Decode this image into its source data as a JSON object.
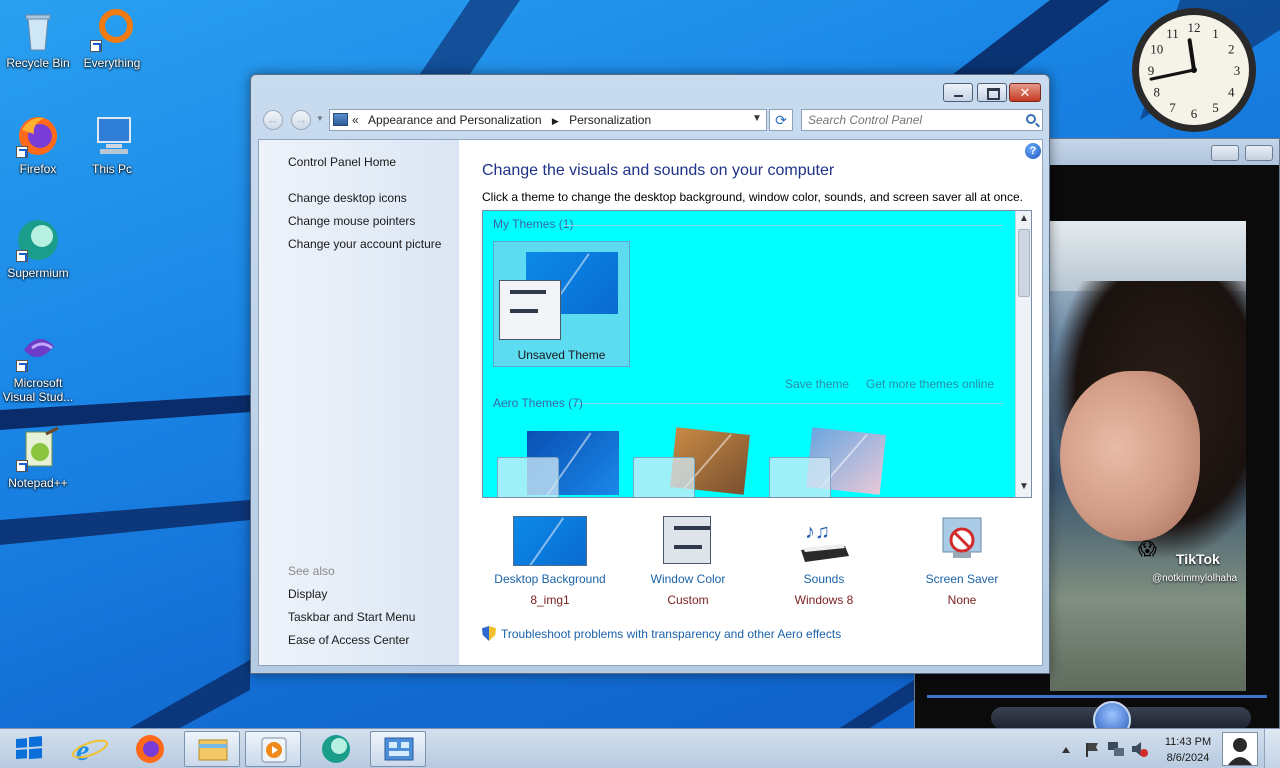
{
  "desktop": {
    "icons": [
      {
        "label": "Recycle Bin"
      },
      {
        "label": "Everything"
      },
      {
        "label": "Firefox"
      },
      {
        "label": "This Pc"
      },
      {
        "label": "Supermium"
      },
      {
        "label": "Microsoft Visual Stud..."
      },
      {
        "label": "Notepad++"
      }
    ]
  },
  "window": {
    "breadcrumbs": [
      "«",
      "Appearance and Personalization",
      "Personalization"
    ],
    "search_placeholder": "Search Control Panel",
    "left_links": [
      "Control Panel Home",
      "Change desktop icons",
      "Change mouse pointers",
      "Change your account picture"
    ],
    "see_also": {
      "title": "See also",
      "links": [
        "Display",
        "Taskbar and Start Menu",
        "Ease of Access Center"
      ]
    },
    "heading": "Change the visuals and sounds on your computer",
    "subtext": "Click a theme to change the desktop background, window color, sounds, and screen saver all at once.",
    "themes": {
      "my_themes_label": "My Themes (1)",
      "unsaved_theme": "Unsaved Theme",
      "save_theme": "Save theme",
      "get_more": "Get more themes online",
      "aero_label": "Aero Themes (7)",
      "background_color": "#00ffff"
    },
    "options": [
      {
        "label": "Desktop Background",
        "value": "8_img1"
      },
      {
        "label": "Window Color",
        "value": "Custom"
      },
      {
        "label": "Sounds",
        "value": "Windows 8"
      },
      {
        "label": "Screen Saver",
        "value": "None"
      }
    ],
    "troubleshoot": "Troubleshoot problems with transparency and other Aero effects",
    "help_glyph": "?"
  },
  "media_window": {
    "watermark": "TikTok",
    "handle": "@notkimmylolhaha"
  },
  "taskbar": {
    "time": "11:43 PM",
    "date": "8/6/2024",
    "pinned": [
      "start-button",
      "internet-explorer-icon",
      "firefox-icon",
      "file-explorer-icon",
      "media-player-icon",
      "supermium-icon",
      "control-panel-icon"
    ]
  },
  "gadget_clock": {
    "hour": 11,
    "minute": 43
  }
}
